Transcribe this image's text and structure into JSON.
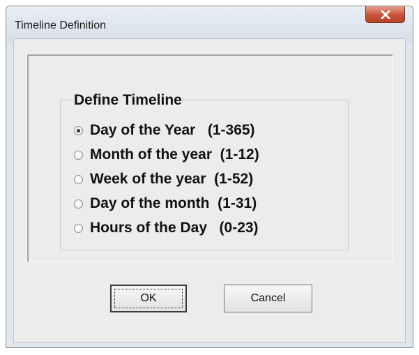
{
  "window": {
    "title": "Timeline Definition",
    "close_icon": "close-x-icon",
    "accent_close_color": "#c9543b"
  },
  "group": {
    "label": "Define Timeline",
    "options": [
      {
        "label": "Day of the Year   (1-365)",
        "selected": true
      },
      {
        "label": "Month of the year  (1-12)",
        "selected": false
      },
      {
        "label": "Week of the year  (1-52)",
        "selected": false
      },
      {
        "label": "Day of the month  (1-31)",
        "selected": false
      },
      {
        "label": "Hours of the Day   (0-23)",
        "selected": false
      }
    ]
  },
  "buttons": {
    "ok_label": "OK",
    "cancel_label": "Cancel"
  }
}
